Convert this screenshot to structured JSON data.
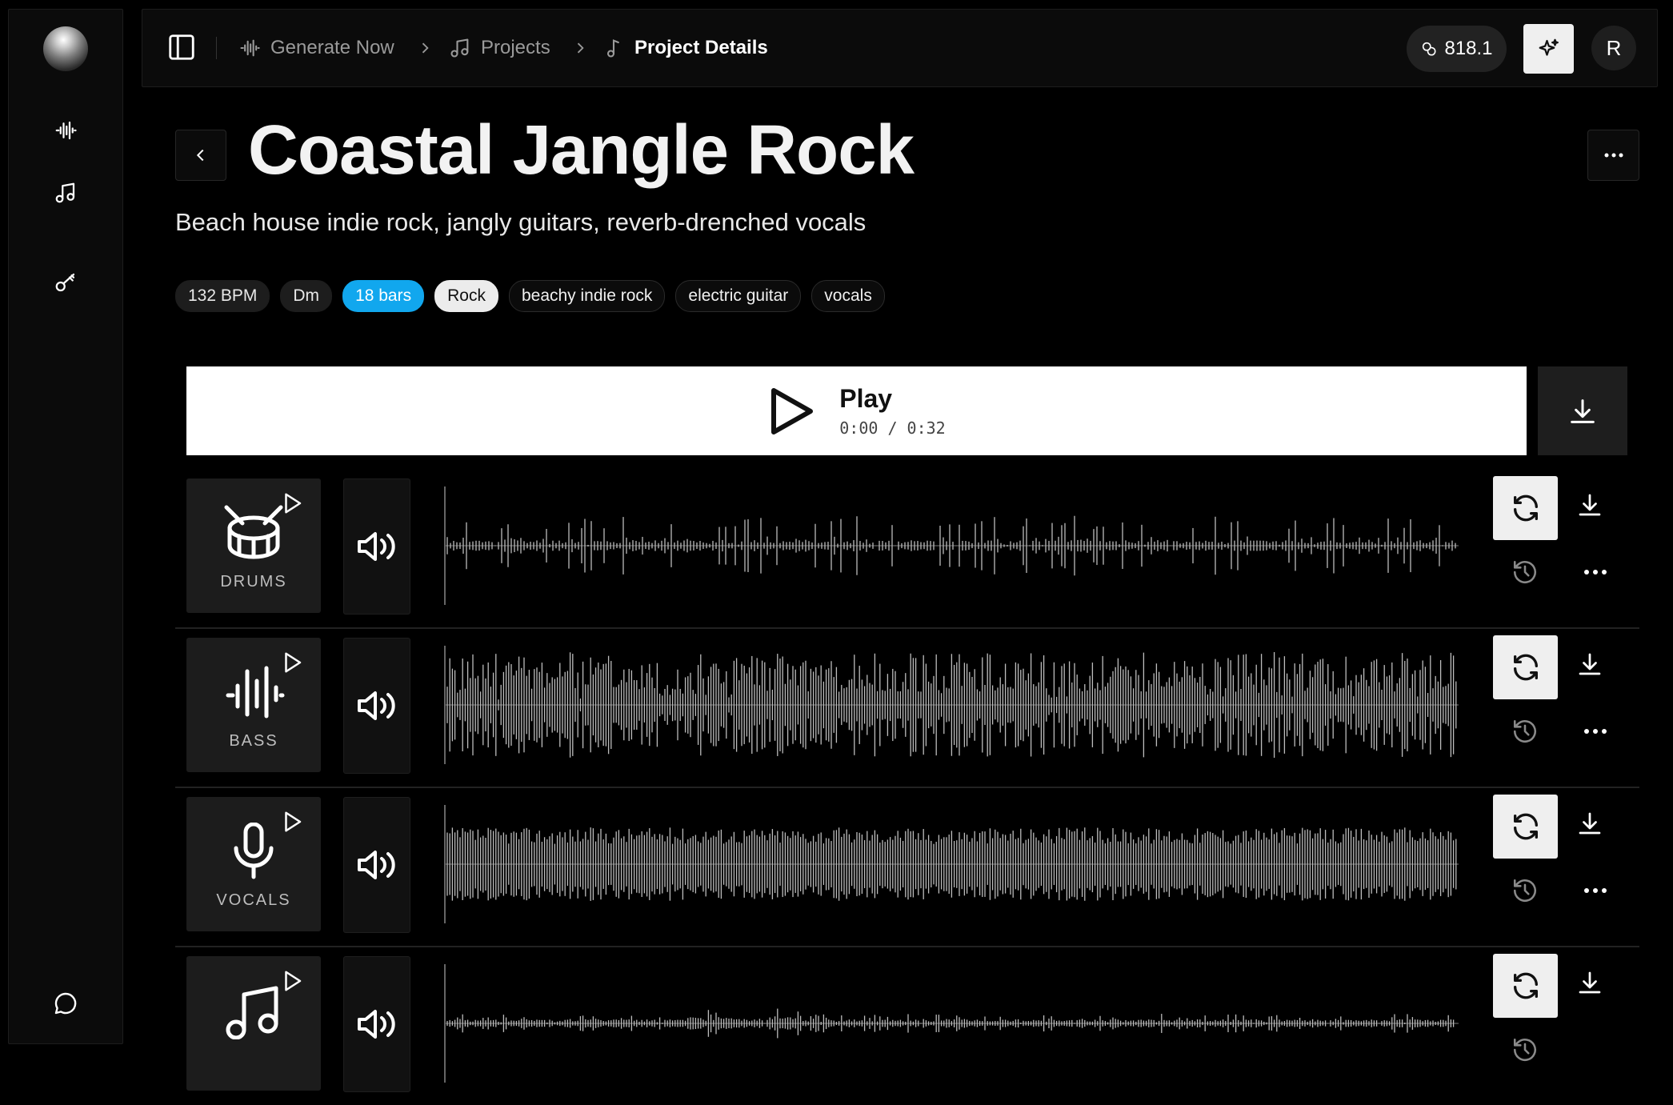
{
  "sidebar": {
    "items": [
      {
        "icon": "waveform-icon"
      },
      {
        "icon": "music-note-icon"
      },
      {
        "icon": "key-icon"
      },
      {
        "icon": "chat-bubble-icon"
      }
    ]
  },
  "breadcrumb": {
    "items": [
      {
        "label": "Generate Now",
        "icon": "waveform-icon"
      },
      {
        "label": "Projects",
        "icon": "music-notes-icon"
      },
      {
        "label": "Project Details",
        "icon": "music-note-icon"
      }
    ]
  },
  "header": {
    "credits": "818.1",
    "user_initial": "R"
  },
  "project": {
    "title": "Coastal Jangle Rock",
    "description": "Beach house indie rock, jangly guitars, reverb-drenched vocals",
    "tags": [
      {
        "label": "132 BPM",
        "style": "dark"
      },
      {
        "label": "Dm",
        "style": "dark"
      },
      {
        "label": "18 bars",
        "style": "blue"
      },
      {
        "label": "Rock",
        "style": "light"
      },
      {
        "label": "beachy indie rock",
        "style": "outline"
      },
      {
        "label": "electric guitar",
        "style": "outline"
      },
      {
        "label": "vocals",
        "style": "outline"
      }
    ]
  },
  "player": {
    "label": "Play",
    "time": "0:00 / 0:32"
  },
  "tracks": [
    {
      "name": "DRUMS",
      "icon": "drum-icon"
    },
    {
      "name": "BASS",
      "icon": "waveform-icon"
    },
    {
      "name": "VOCALS",
      "icon": "microphone-icon"
    },
    {
      "name": "",
      "icon": "music-notes-icon"
    }
  ],
  "colors": {
    "accent_blue": "#11a7ee",
    "background": "#000000",
    "panel": "#0b0b0b"
  }
}
